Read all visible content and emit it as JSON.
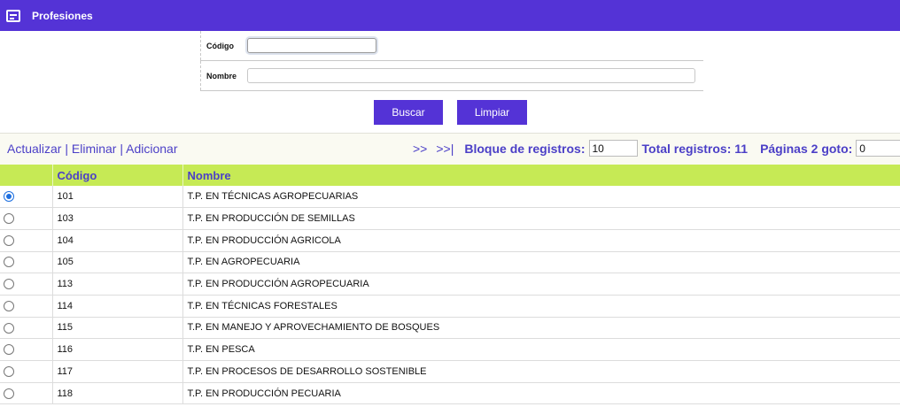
{
  "header": {
    "title": "Profesiones",
    "icon": "list-card-icon"
  },
  "search_form": {
    "code_label": "Código",
    "code_value": "",
    "name_label": "Nombre",
    "name_value": ""
  },
  "buttons": {
    "search": "Buscar",
    "clear": "Limpiar"
  },
  "toolbar": {
    "refresh": "Actualizar",
    "separator": "|",
    "delete": "Eliminar",
    "add": "Adicionar",
    "next": ">>",
    "last": ">>|",
    "block_label": "Bloque de registros:",
    "block_value": "10",
    "total_label": "Total registros: 11",
    "pages_label": "Páginas 2 goto:",
    "goto_value": "0"
  },
  "table": {
    "columns": [
      "",
      "Código",
      "Nombre"
    ],
    "rows": [
      {
        "selected": true,
        "code": "101",
        "name": "T.P. EN TÉCNICAS AGROPECUARIAS"
      },
      {
        "selected": false,
        "code": "103",
        "name": "T.P. EN PRODUCCIÓN DE SEMILLAS"
      },
      {
        "selected": false,
        "code": "104",
        "name": "T.P. EN PRODUCCIÓN AGRICOLA"
      },
      {
        "selected": false,
        "code": "105",
        "name": "T.P. EN AGROPECUARIA"
      },
      {
        "selected": false,
        "code": "113",
        "name": "T.P. EN PRODUCCIÓN AGROPECUARIA"
      },
      {
        "selected": false,
        "code": "114",
        "name": "T.P. EN TÉCNICAS FORESTALES"
      },
      {
        "selected": false,
        "code": "115",
        "name": "T.P. EN MANEJO Y APROVECHAMIENTO DE BOSQUES"
      },
      {
        "selected": false,
        "code": "116",
        "name": "T.P. EN PESCA"
      },
      {
        "selected": false,
        "code": "117",
        "name": "T.P. EN PROCESOS DE DESARROLLO SOSTENIBLE"
      },
      {
        "selected": false,
        "code": "118",
        "name": "T.P. EN PRODUCCIÓN PECUARIA"
      }
    ]
  },
  "colors": {
    "primary": "#5433d6",
    "link": "#4b3fc7",
    "table_header": "#c6ea55",
    "radio_checked": "#1d6fe0"
  }
}
